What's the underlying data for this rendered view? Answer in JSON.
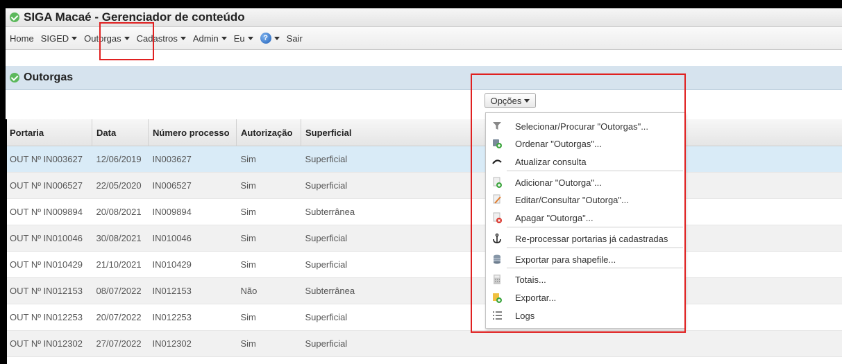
{
  "app": {
    "title": "SIGA Macaé - Gerenciador de conteúdo"
  },
  "menu": {
    "items": [
      {
        "label": "Home",
        "caret": false
      },
      {
        "label": "SIGED",
        "caret": true
      },
      {
        "label": "Outorgas",
        "caret": true
      },
      {
        "label": "Cadastros",
        "caret": true
      },
      {
        "label": "Admin",
        "caret": true
      },
      {
        "label": "Eu",
        "caret": true
      }
    ],
    "help_icon": "help-icon",
    "exit_label": "Sair"
  },
  "panel": {
    "title": "Outorgas",
    "options_label": "Opções"
  },
  "table": {
    "columns": [
      "Portaria",
      "Data",
      "Número processo",
      "Autorização",
      "Superficial"
    ],
    "rows": [
      [
        "OUT Nº IN003627",
        "12/06/2019",
        "IN003627",
        "Sim",
        "Superficial"
      ],
      [
        "OUT Nº IN006527",
        "22/05/2020",
        "IN006527",
        "Sim",
        "Superficial"
      ],
      [
        "OUT Nº IN009894",
        "20/08/2021",
        "IN009894",
        "Sim",
        "Subterrânea"
      ],
      [
        "OUT Nº IN010046",
        "30/08/2021",
        "IN010046",
        "Sim",
        "Superficial"
      ],
      [
        "OUT Nº IN010429",
        "21/10/2021",
        "IN010429",
        "Sim",
        "Superficial"
      ],
      [
        "OUT Nº IN012153",
        "08/07/2022",
        "IN012153",
        "Não",
        "Subterrânea"
      ],
      [
        "OUT Nº IN012253",
        "20/07/2022",
        "IN012253",
        "Sim",
        "Superficial"
      ],
      [
        "OUT Nº IN012302",
        "27/07/2022",
        "IN012302",
        "Sim",
        "Superficial"
      ]
    ]
  },
  "options_menu": {
    "items": [
      {
        "label": "Selecionar/Procurar \"Outorgas\"...",
        "icon": "filter-icon"
      },
      {
        "label": "Ordenar \"Outorgas\"...",
        "icon": "sort-icon"
      },
      {
        "label": "Atualizar consulta",
        "icon": "refresh-icon"
      },
      {
        "label": "Adicionar \"Outorga\"...",
        "icon": "add-icon"
      },
      {
        "label": "Editar/Consultar \"Outorga\"...",
        "icon": "edit-icon"
      },
      {
        "label": "Apagar \"Outorga\"...",
        "icon": "delete-icon"
      },
      {
        "label": "Re-processar portarias já cadastradas",
        "icon": "anchor-icon"
      },
      {
        "label": "Exportar para shapefile...",
        "icon": "database-icon"
      },
      {
        "label": "Totais...",
        "icon": "calculator-icon"
      },
      {
        "label": "Exportar...",
        "icon": "export-icon"
      },
      {
        "label": "Logs",
        "icon": "list-icon"
      }
    ]
  }
}
